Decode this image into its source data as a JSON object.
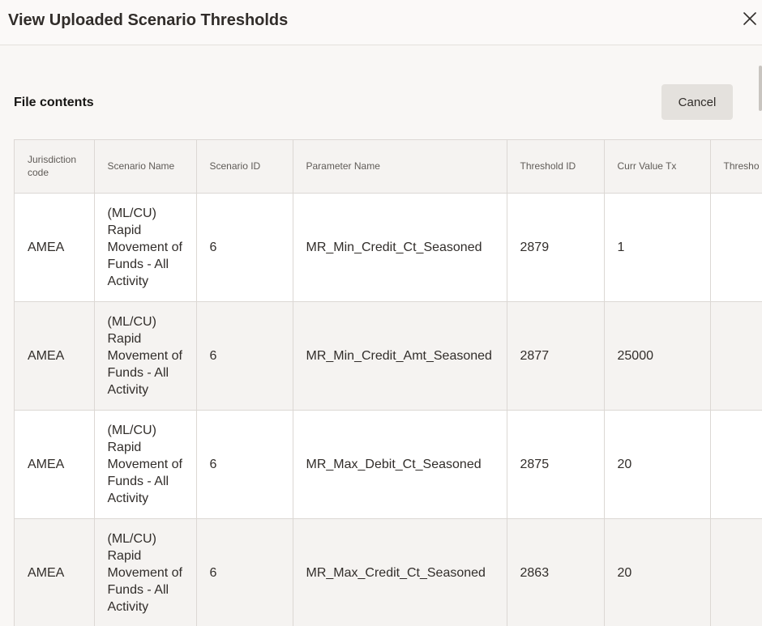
{
  "dialog": {
    "title": "View Uploaded Scenario Thresholds",
    "close_icon": "close-icon"
  },
  "section": {
    "title": "File contents",
    "cancel_label": "Cancel"
  },
  "table": {
    "columns": [
      "Jurisdiction code",
      "Scenario Name",
      "Scenario ID",
      "Parameter Name",
      "Threshold ID",
      "Curr Value Tx",
      "Thresho"
    ],
    "rows": [
      {
        "jurisdiction": "AMEA",
        "scenario_name": "(ML/CU) Rapid Movement of Funds - All Activity",
        "scenario_id": "6",
        "parameter_name": "MR_Min_Credit_Ct_Seasoned",
        "threshold_id": "2879",
        "curr_value": "1",
        "threshold_type": ""
      },
      {
        "jurisdiction": "AMEA",
        "scenario_name": "(ML/CU) Rapid Movement of Funds - All Activity",
        "scenario_id": "6",
        "parameter_name": "MR_Min_Credit_Amt_Seasoned",
        "threshold_id": "2877",
        "curr_value": "25000",
        "threshold_type": ""
      },
      {
        "jurisdiction": "AMEA",
        "scenario_name": "(ML/CU) Rapid Movement of Funds - All Activity",
        "scenario_id": "6",
        "parameter_name": "MR_Max_Debit_Ct_Seasoned",
        "threshold_id": "2875",
        "curr_value": "20",
        "threshold_type": ""
      },
      {
        "jurisdiction": "AMEA",
        "scenario_name": "(ML/CU) Rapid Movement of Funds - All Activity",
        "scenario_id": "6",
        "parameter_name": "MR_Max_Credit_Ct_Seasoned",
        "threshold_id": "2863",
        "curr_value": "20",
        "threshold_type": ""
      }
    ]
  }
}
